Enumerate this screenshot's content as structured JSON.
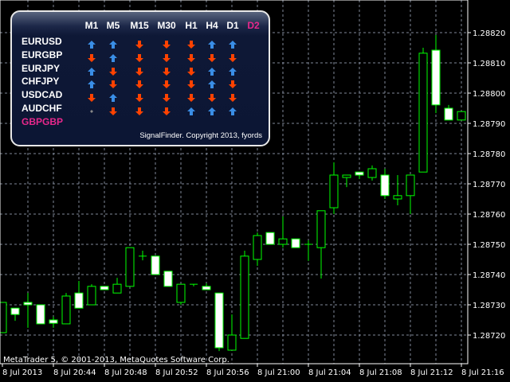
{
  "panel": {
    "timeframes": [
      "M1",
      "M5",
      "M15",
      "M30",
      "H1",
      "H4",
      "D1",
      "D2"
    ],
    "highlight_timeframe": "D2",
    "rows": [
      {
        "symbol": "EURUSD",
        "signals": [
          "up",
          "up",
          "down",
          "down",
          "down",
          "up",
          "up"
        ]
      },
      {
        "symbol": "EURGBP",
        "signals": [
          "down",
          "up",
          "down",
          "down",
          "down",
          "down",
          "down"
        ]
      },
      {
        "symbol": "EURJPY",
        "signals": [
          "up",
          "down",
          "down",
          "down",
          "down",
          "up",
          "up"
        ]
      },
      {
        "symbol": "CHFJPY",
        "signals": [
          "up",
          "down",
          "down",
          "down",
          "down",
          "up",
          "down"
        ]
      },
      {
        "symbol": "USDCAD",
        "signals": [
          "down",
          "up",
          "down",
          "down",
          "down",
          "down",
          "down"
        ]
      },
      {
        "symbol": "AUDCHF",
        "signals": [
          "neutral",
          "down",
          "down",
          "down",
          "up",
          "up",
          "up"
        ]
      },
      {
        "symbol": "GBPGBP",
        "signals": []
      }
    ],
    "copyright": "SignalFinder. Copyright 2013, fyords",
    "colors": {
      "up": "#3a8ee6",
      "down": "#ff4200",
      "neutral": "#888888",
      "highlight": "#e8288c",
      "symbol_highlight": "#e8288c"
    }
  },
  "watermark": "MetaTrader 5, © 2001-2013, MetaQuotes Software Corp.",
  "chart_data": {
    "type": "candlestick",
    "timeframe": "M1",
    "xlabel": "",
    "ylabel": "",
    "ylim": [
      1.28712,
      1.2883
    ],
    "y_ticks": [
      "1.28720",
      "1.28730",
      "1.28740",
      "1.28750",
      "1.28760",
      "1.28770",
      "1.28780",
      "1.28790",
      "1.28800",
      "1.28810",
      "1.28820"
    ],
    "x_ticks": [
      "8 Jul 2013",
      "8 Jul 20:44",
      "8 Jul 20:48",
      "8 Jul 20:52",
      "8 Jul 20:56",
      "8 Jul 21:00",
      "8 Jul 21:04",
      "8 Jul 21:08",
      "8 Jul 21:12",
      "8 Jul 21:16"
    ],
    "grid": true,
    "colors": {
      "background": "#000000",
      "candle_outline": "#00ff00",
      "bear_fill": "#ffffff",
      "bull_fill": "#000000",
      "grid": "#7f8899"
    },
    "candles": [
      {
        "t": "20:40",
        "o": 1.287208,
        "h": 1.287308,
        "l": 1.287208,
        "c": 1.287308
      },
      {
        "t": "20:41",
        "o": 1.287289,
        "h": 1.287289,
        "l": 1.287247,
        "c": 1.287268
      },
      {
        "t": "20:42",
        "o": 1.287308,
        "h": 1.287339,
        "l": 1.287224,
        "c": 1.2873
      },
      {
        "t": "20:43",
        "o": 1.2873,
        "h": 1.2873,
        "l": 1.287237,
        "c": 1.287237
      },
      {
        "t": "20:44",
        "o": 1.28725,
        "h": 1.287261,
        "l": 1.287224,
        "c": 1.287239
      },
      {
        "t": "20:45",
        "o": 1.287237,
        "h": 1.287339,
        "l": 1.287237,
        "c": 1.287329
      },
      {
        "t": "20:46",
        "o": 1.287339,
        "h": 1.287379,
        "l": 1.287289,
        "c": 1.287289
      },
      {
        "t": "20:47",
        "o": 1.2873,
        "h": 1.287368,
        "l": 1.2873,
        "c": 1.287361
      },
      {
        "t": "20:48",
        "o": 1.287361,
        "h": 1.287361,
        "l": 1.28735,
        "c": 1.28735
      },
      {
        "t": "20:49",
        "o": 1.287339,
        "h": 1.287389,
        "l": 1.287339,
        "c": 1.287368
      },
      {
        "t": "20:50",
        "o": 1.287361,
        "h": 1.287489,
        "l": 1.287361,
        "c": 1.287489
      },
      {
        "t": "20:51",
        "o": 1.287461,
        "h": 1.287479,
        "l": 1.287447,
        "c": 1.287461
      },
      {
        "t": "20:52",
        "o": 1.287461,
        "h": 1.287461,
        "l": 1.2874,
        "c": 1.2874
      },
      {
        "t": "20:53",
        "o": 1.287411,
        "h": 1.287411,
        "l": 1.287361,
        "c": 1.287361
      },
      {
        "t": "20:54",
        "o": 1.287308,
        "h": 1.287368,
        "l": 1.2873,
        "c": 1.287368
      },
      {
        "t": "20:55",
        "o": 1.287368,
        "h": 1.287368,
        "l": 1.287361,
        "c": 1.287368
      },
      {
        "t": "20:56",
        "o": 1.287361,
        "h": 1.287371,
        "l": 1.28735,
        "c": 1.28735
      },
      {
        "t": "20:57",
        "o": 1.287339,
        "h": 1.287339,
        "l": 1.287147,
        "c": 1.287158
      },
      {
        "t": "20:58",
        "o": 1.28715,
        "h": 1.287268,
        "l": 1.28715,
        "c": 1.2872
      },
      {
        "t": "20:59",
        "o": 1.287189,
        "h": 1.287479,
        "l": 1.287189,
        "c": 1.287461
      },
      {
        "t": "21:00",
        "o": 1.28745,
        "h": 1.287539,
        "l": 1.287429,
        "c": 1.287529
      },
      {
        "t": "21:01",
        "o": 1.287539,
        "h": 1.287539,
        "l": 1.2875,
        "c": 1.2875
      },
      {
        "t": "21:02",
        "o": 1.2875,
        "h": 1.287592,
        "l": 1.287489,
        "c": 1.287518
      },
      {
        "t": "21:03",
        "o": 1.287518,
        "h": 1.287518,
        "l": 1.287489,
        "c": 1.287489
      },
      {
        "t": "21:04",
        "o": 1.2875,
        "h": 1.287513,
        "l": 1.287445,
        "c": 1.2875
      },
      {
        "t": "21:05",
        "o": 1.287489,
        "h": 1.287611,
        "l": 1.287387,
        "c": 1.287611
      },
      {
        "t": "21:06",
        "o": 1.287621,
        "h": 1.287771,
        "l": 1.2876,
        "c": 1.287729
      },
      {
        "t": "21:07",
        "o": 1.287721,
        "h": 1.287729,
        "l": 1.287689,
        "c": 1.287729
      },
      {
        "t": "21:08",
        "o": 1.287739,
        "h": 1.287739,
        "l": 1.287716,
        "c": 1.287729
      },
      {
        "t": "21:09",
        "o": 1.287721,
        "h": 1.287761,
        "l": 1.287711,
        "c": 1.28775
      },
      {
        "t": "21:10",
        "o": 1.287729,
        "h": 1.28775,
        "l": 1.28765,
        "c": 1.287661
      },
      {
        "t": "21:11",
        "o": 1.28765,
        "h": 1.287729,
        "l": 1.287629,
        "c": 1.287661
      },
      {
        "t": "21:12",
        "o": 1.287661,
        "h": 1.287729,
        "l": 1.2876,
        "c": 1.287729
      },
      {
        "t": "21:13",
        "o": 1.287739,
        "h": 1.28815,
        "l": 1.287739,
        "c": 1.288132
      },
      {
        "t": "21:14",
        "o": 1.288142,
        "h": 1.288192,
        "l": 1.287934,
        "c": 1.287961
      },
      {
        "t": "21:15",
        "o": 1.28795,
        "h": 1.287961,
        "l": 1.287911,
        "c": 1.287911
      },
      {
        "t": "21:16",
        "o": 1.287911,
        "h": 1.287939,
        "l": 1.287911,
        "c": 1.287939
      }
    ]
  }
}
